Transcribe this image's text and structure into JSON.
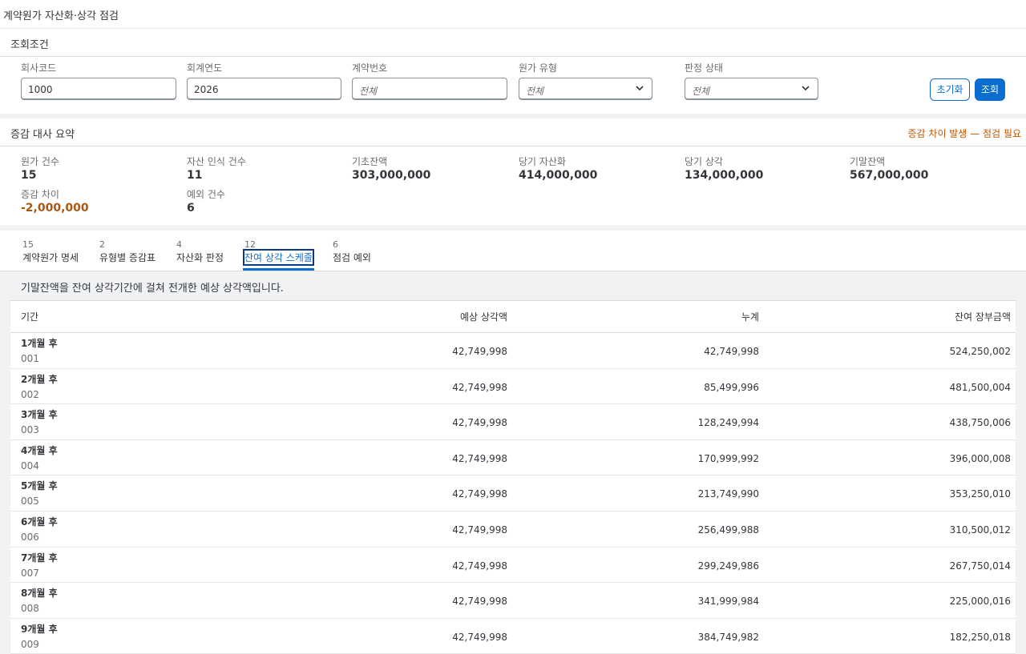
{
  "page": {
    "title": "계약원가 자산화·상각 점검"
  },
  "filter": {
    "section_title": "조회조건",
    "company_code": {
      "label": "회사코드",
      "value": "1000"
    },
    "fiscal_year": {
      "label": "회계연도",
      "value": "2026"
    },
    "contract_no": {
      "label": "계약번호",
      "placeholder": "전체"
    },
    "cost_type": {
      "label": "원가 유형",
      "value": "전체"
    },
    "judgement_status": {
      "label": "판정 상태",
      "value": "전체"
    },
    "reset_label": "초기화",
    "search_label": "조회"
  },
  "summary": {
    "section_title": "증감 대사 요약",
    "status": "증감 차이 발생 — 점검 필요",
    "status_color": "#c35500",
    "kpis": [
      {
        "label": "원가 건수",
        "value": "15"
      },
      {
        "label": "자산 인식 건수",
        "value": "11"
      },
      {
        "label": "기초잔액",
        "value": "303,000,000"
      },
      {
        "label": "당기 자산화",
        "value": "414,000,000"
      },
      {
        "label": "당기 상각",
        "value": "134,000,000"
      },
      {
        "label": "기말잔액",
        "value": "567,000,000"
      },
      {
        "label": "증감 차이",
        "value": "-2,000,000"
      },
      {
        "label": "예외 건수",
        "value": "6"
      }
    ]
  },
  "tabs": [
    {
      "count": "15",
      "label": "계약원가 명세"
    },
    {
      "count": "2",
      "label": "유형별 증감표"
    },
    {
      "count": "4",
      "label": "자산화 판정"
    },
    {
      "count": "12",
      "label": "잔여 상각 스케줄",
      "active": true
    },
    {
      "count": "6",
      "label": "점검 예외"
    }
  ],
  "schedule": {
    "description": "기말잔액을 잔여 상각기간에 걸쳐 전개한 예상 상각액입니다.",
    "columns": [
      "기간",
      "예상 상각액",
      "누계",
      "잔여 장부금액"
    ],
    "rows": [
      {
        "period": "1개월 후",
        "code": "001",
        "amount": "42,749,998",
        "cumulative": "42,749,998",
        "remaining": "524,250,002"
      },
      {
        "period": "2개월 후",
        "code": "002",
        "amount": "42,749,998",
        "cumulative": "85,499,996",
        "remaining": "481,500,004"
      },
      {
        "period": "3개월 후",
        "code": "003",
        "amount": "42,749,998",
        "cumulative": "128,249,994",
        "remaining": "438,750,006"
      },
      {
        "period": "4개월 후",
        "code": "004",
        "amount": "42,749,998",
        "cumulative": "170,999,992",
        "remaining": "396,000,008"
      },
      {
        "period": "5개월 후",
        "code": "005",
        "amount": "42,749,998",
        "cumulative": "213,749,990",
        "remaining": "353,250,010"
      },
      {
        "period": "6개월 후",
        "code": "006",
        "amount": "42,749,998",
        "cumulative": "256,499,988",
        "remaining": "310,500,012"
      },
      {
        "period": "7개월 후",
        "code": "007",
        "amount": "42,749,998",
        "cumulative": "299,249,986",
        "remaining": "267,750,014"
      },
      {
        "period": "8개월 후",
        "code": "008",
        "amount": "42,749,998",
        "cumulative": "341,999,984",
        "remaining": "225,000,016"
      },
      {
        "period": "9개월 후",
        "code": "009",
        "amount": "42,749,998",
        "cumulative": "384,749,982",
        "remaining": "182,250,018"
      }
    ]
  }
}
